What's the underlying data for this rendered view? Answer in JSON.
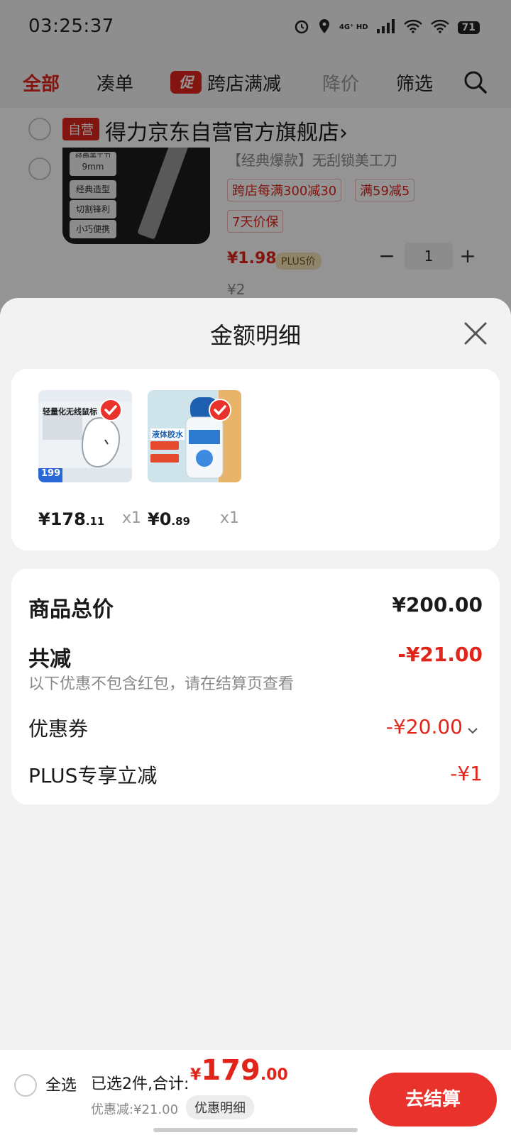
{
  "colors": {
    "accent": "#e1251b",
    "sheet_bg": "#f2f2f2",
    "card_bg": "#ffffff",
    "muted": "#888888"
  },
  "status_bar": {
    "time": "03:25:37",
    "network": "4G⁺ HD",
    "battery": "71"
  },
  "tabs": [
    {
      "label": "全部",
      "active": true
    },
    {
      "label": "凑单"
    },
    {
      "label": "跨店满减",
      "badge": "促"
    },
    {
      "label": "降价"
    },
    {
      "label": "筛选"
    }
  ],
  "store": {
    "badge": "自营",
    "name": "得力京东自营官方旗舰店",
    "chevron": "›"
  },
  "cart_product": {
    "title": "【经典爆款】无刮锁美工刀",
    "thumb_chips": [
      "经典美工刀",
      "9mm",
      "经典造型",
      "切割锋利",
      "小巧便携"
    ],
    "promos": [
      "跨店每满300减30",
      "满59减5"
    ],
    "price_guard": "7天价保",
    "plus_price": "¥1.98",
    "plus_tag": "PLUS价",
    "orig_price": "¥2",
    "quantity": "1",
    "minus": "−",
    "plus": "+"
  },
  "sheet": {
    "title": "金额明细",
    "items": [
      {
        "icon": "wireless-mouse-product-image",
        "img_title": "轻量化无线鼠标",
        "img_price": "199",
        "price_int": "¥178",
        "price_dec": ".11",
        "qty": "x1"
      },
      {
        "icon": "liquid-glue-product-image",
        "img_title": "液体胶水",
        "price_int": "¥0",
        "price_dec": ".89",
        "qty": "x1"
      }
    ],
    "summary": {
      "goods_total_label": "商品总价",
      "goods_total_value": "¥200.00",
      "reduce_label": "共减",
      "reduce_value": "-¥21.00",
      "reduce_note": "以下优惠不包含红包，请在结算页查看",
      "coupon_label": "优惠券",
      "coupon_value": "-¥20.00",
      "plus_label": "PLUS专享立减",
      "plus_value": "-¥1"
    }
  },
  "bottom_bar": {
    "select_all": "全选",
    "selected_summary": "已选2件,合计:",
    "total_currency": "¥",
    "total_int": "179",
    "total_dec": ".00",
    "discount": "优惠减:¥21.00",
    "detail_button": "优惠明细",
    "checkout_label": "去结算"
  }
}
